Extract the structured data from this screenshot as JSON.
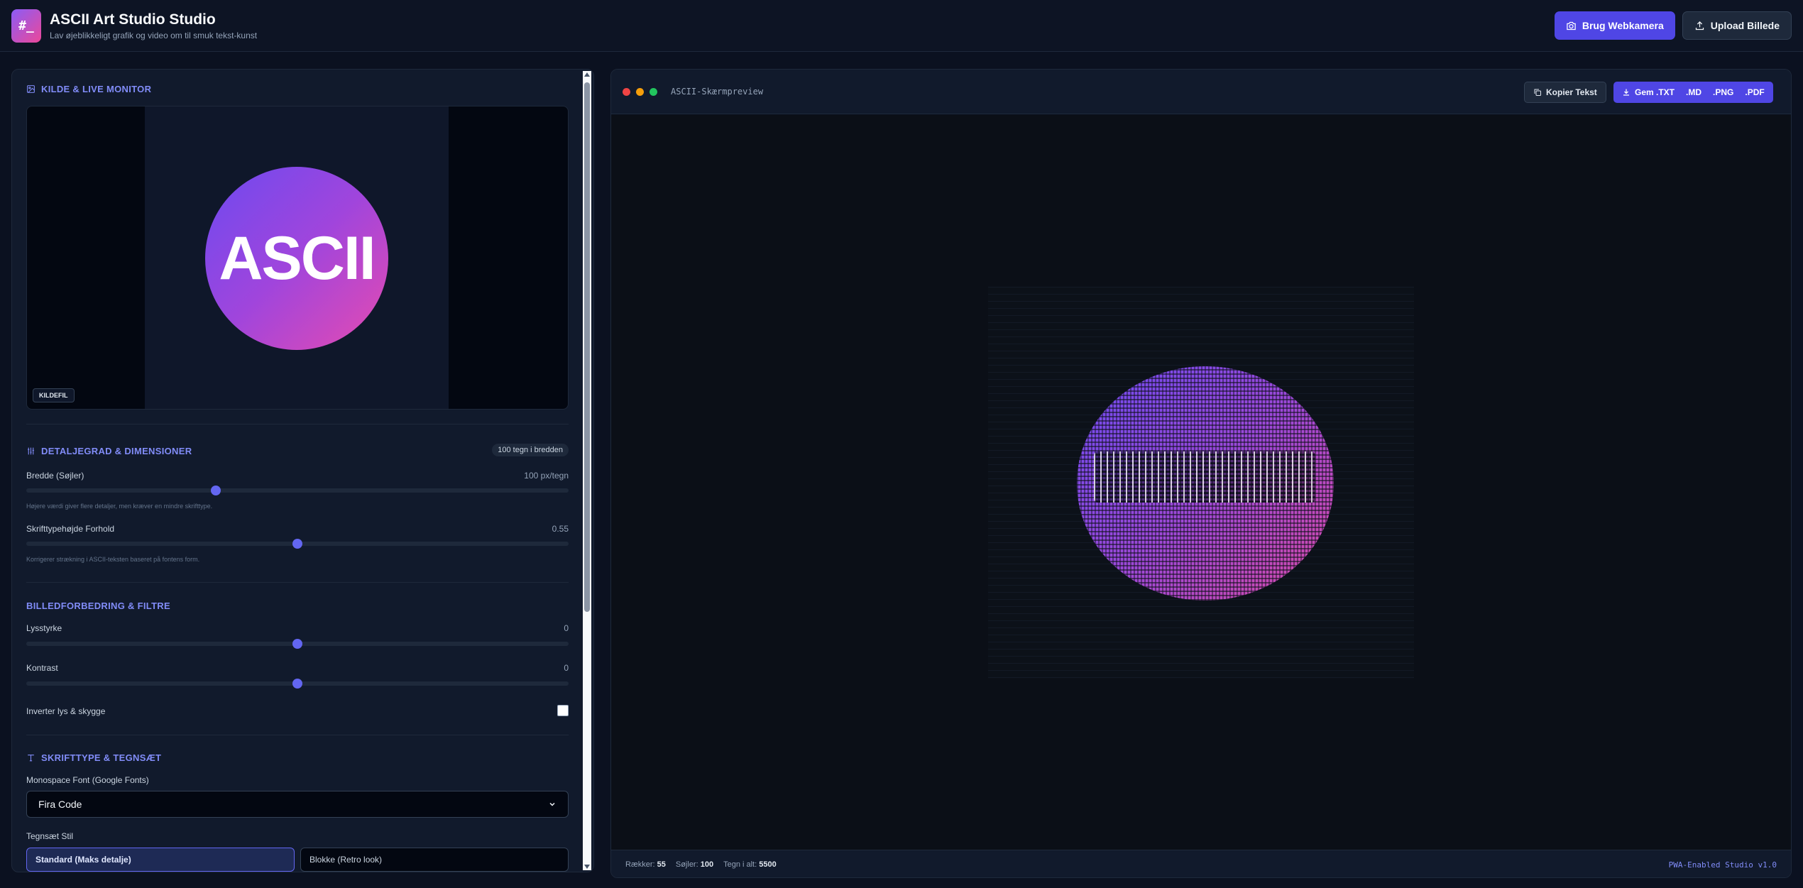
{
  "header": {
    "logo_text": "#_",
    "title": "ASCII Art Studio Studio",
    "subtitle": "Lav øjeblikkeligt grafik og video om til smuk tekst-kunst",
    "webcam_label": "Brug Webkamera",
    "upload_label": "Upload Billede"
  },
  "source": {
    "title": "KILDE & LIVE MONITOR",
    "image_text": "ASCII",
    "badge": "KILDEFIL"
  },
  "detail": {
    "title": "DETALJEGRAD & DIMENSIONER",
    "pill": "100 tegn i bredden",
    "width_label": "Bredde (Søjler)",
    "width_value": "100 px/tegn",
    "width_level": 0.35,
    "width_hint": "Højere værdi giver flere detaljer, men kræver en mindre skrifttype.",
    "ratio_label": "Skrifttypehøjde Forhold",
    "ratio_value": "0.55",
    "ratio_level": 0.5,
    "ratio_hint": "Korrigerer strækning i ASCII-teksten baseret på fontens form."
  },
  "filters": {
    "title": "BILLEDFORBEDRING & FILTRE",
    "brightness_label": "Lysstyrke",
    "brightness_value": "0",
    "brightness_level": 0.5,
    "contrast_label": "Kontrast",
    "contrast_value": "0",
    "contrast_level": 0.5,
    "invert_label": "Inverter lys & skygge",
    "invert_checked": false
  },
  "font": {
    "title": "SKRIFTTYPE & TEGNSÆT",
    "font_label": "Monospace Font (Google Fonts)",
    "font_selected": "Fira Code",
    "charset_label": "Tegnsæt Stil",
    "charset_standard": "Standard (Maks detalje)",
    "charset_blocks": "Blokke (Retro look)"
  },
  "preview": {
    "title": "ASCII-Skærmpreview",
    "copy_label": "Kopier Tekst",
    "save_txt": "Gem .TXT",
    "md": ".MD",
    "png": ".PNG",
    "pdf": ".PDF"
  },
  "status": {
    "rows_label": "Rækker:",
    "rows_value": "55",
    "cols_label": "Søjler:",
    "cols_value": "100",
    "total_label": "Tegn i alt:",
    "total_value": "5500",
    "pwa": "PWA-Enabled Studio v1.0"
  },
  "colors": {
    "accent": "#4f46e5",
    "section_title": "#818cf8",
    "gradient_start": "#6d4af0",
    "gradient_end": "#e74bb0",
    "dot_red": "#ef4444",
    "dot_yellow": "#f59e0b",
    "dot_green": "#22c55e"
  }
}
